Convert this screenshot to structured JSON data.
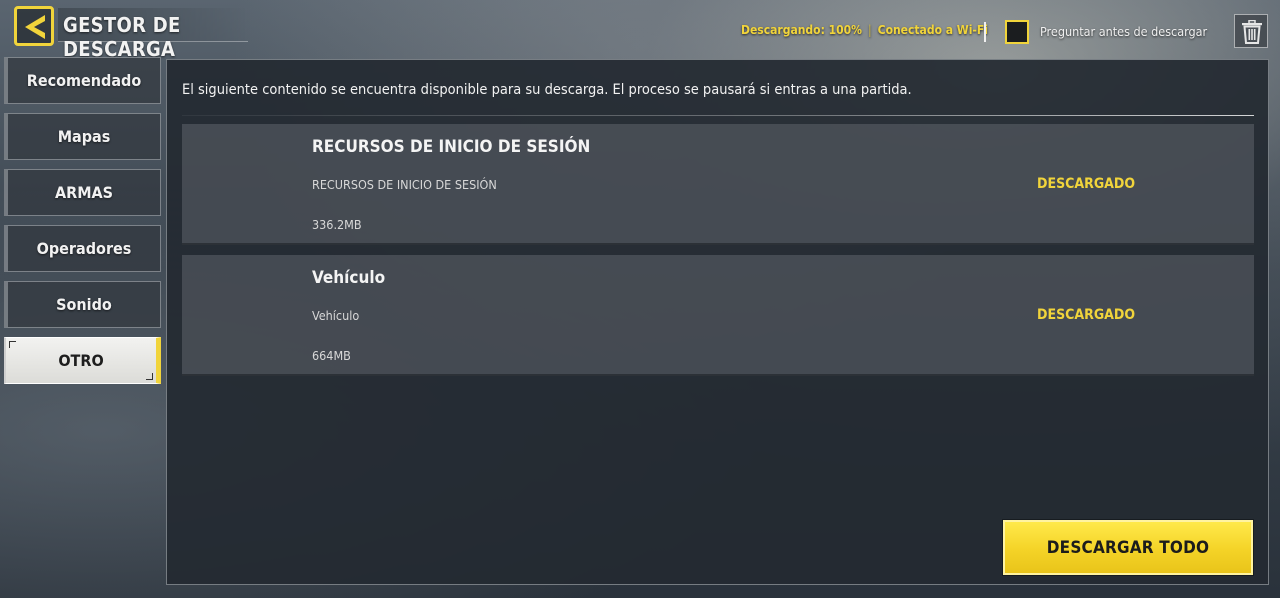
{
  "header": {
    "title": "GESTOR DE DESCARGA",
    "status_downloading": "Descargando: 100%",
    "status_separator": "|",
    "status_connection": "Conectado a Wi-Fi",
    "ask_before_download_label": "Preguntar antes de descargar",
    "ask_before_download_checked": false
  },
  "sidebar": {
    "items": [
      {
        "label": "Recomendado",
        "active": false
      },
      {
        "label": "Mapas",
        "active": false
      },
      {
        "label": "ARMAS",
        "active": false
      },
      {
        "label": "Operadores",
        "active": false
      },
      {
        "label": "Sonido",
        "active": false
      },
      {
        "label": "OTRO",
        "active": true
      }
    ]
  },
  "main": {
    "info": "El siguiente contenido se encuentra disponible para su descarga. El proceso se pausará si entras a una partida.",
    "items": [
      {
        "title": "RECURSOS DE INICIO DE SESIÓN",
        "subtitle": "RECURSOS DE INICIO DE SESIÓN",
        "size": "336.2MB",
        "status": "DESCARGADO"
      },
      {
        "title": "Vehículo",
        "subtitle": "Vehículo",
        "size": "664MB",
        "status": "DESCARGADO"
      }
    ],
    "download_all_label": "DESCARGAR TODO"
  },
  "icons": {
    "back": "back-arrow-icon",
    "trash": "trash-icon"
  },
  "colors": {
    "accent": "#f1d43b",
    "panel": "#242a32",
    "button": "#f4d327"
  }
}
